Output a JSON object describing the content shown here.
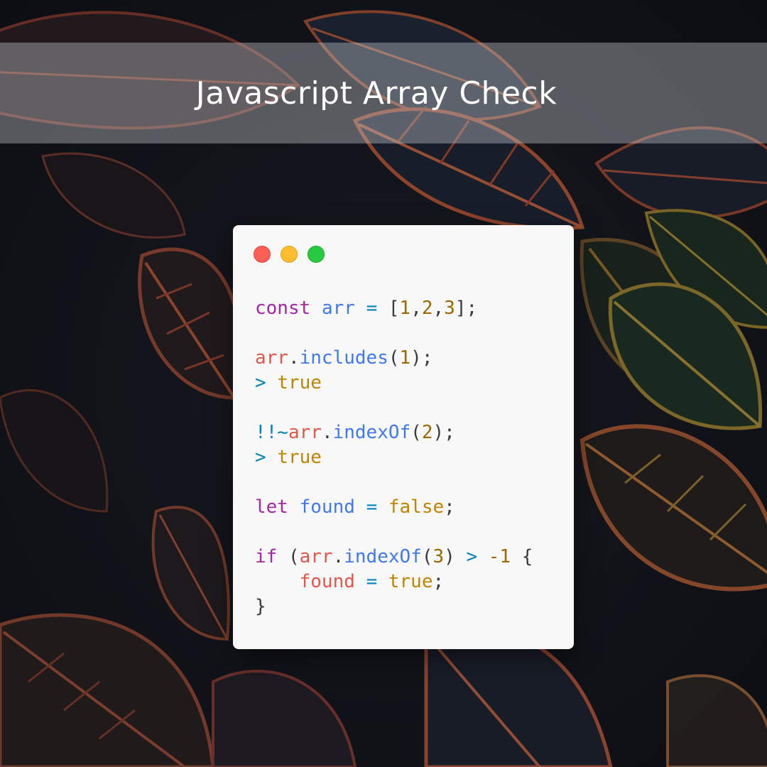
{
  "title": "Javascript Array Check",
  "window": {
    "controls": [
      {
        "name": "close-button",
        "color": "#ff5f56",
        "border": "#e0443e"
      },
      {
        "name": "minimize-button",
        "color": "#ffbd2e",
        "border": "#dea123"
      },
      {
        "name": "zoom-button",
        "color": "#27c93f",
        "border": "#1aab29"
      }
    ]
  },
  "colors": {
    "keyword": "#a626a4",
    "variable": "#e45649",
    "function": "#4078f2",
    "number": "#986801",
    "boolean": "#c18401",
    "operator": "#0184bc",
    "plain": "#383a42",
    "result": "#c18401"
  },
  "code_lines": [
    [
      {
        "text": "const",
        "type": "keyword"
      },
      {
        "text": " ",
        "type": "plain"
      },
      {
        "text": "arr",
        "type": "function"
      },
      {
        "text": " ",
        "type": "plain"
      },
      {
        "text": "=",
        "type": "operator"
      },
      {
        "text": " [",
        "type": "plain"
      },
      {
        "text": "1",
        "type": "number"
      },
      {
        "text": ",",
        "type": "plain"
      },
      {
        "text": "2",
        "type": "number"
      },
      {
        "text": ",",
        "type": "plain"
      },
      {
        "text": "3",
        "type": "number"
      },
      {
        "text": "];",
        "type": "plain"
      }
    ],
    [],
    [
      {
        "text": "arr",
        "type": "variable"
      },
      {
        "text": ".",
        "type": "plain"
      },
      {
        "text": "includes",
        "type": "function"
      },
      {
        "text": "(",
        "type": "plain"
      },
      {
        "text": "1",
        "type": "number"
      },
      {
        "text": ");",
        "type": "plain"
      }
    ],
    [
      {
        "text": ">",
        "type": "operator"
      },
      {
        "text": " ",
        "type": "plain"
      },
      {
        "text": "true",
        "type": "boolean"
      }
    ],
    [],
    [
      {
        "text": "!!~",
        "type": "operator"
      },
      {
        "text": "arr",
        "type": "variable"
      },
      {
        "text": ".",
        "type": "plain"
      },
      {
        "text": "indexOf",
        "type": "function"
      },
      {
        "text": "(",
        "type": "plain"
      },
      {
        "text": "2",
        "type": "number"
      },
      {
        "text": ");",
        "type": "plain"
      }
    ],
    [
      {
        "text": ">",
        "type": "operator"
      },
      {
        "text": " ",
        "type": "plain"
      },
      {
        "text": "true",
        "type": "boolean"
      }
    ],
    [],
    [
      {
        "text": "let",
        "type": "keyword"
      },
      {
        "text": " ",
        "type": "plain"
      },
      {
        "text": "found",
        "type": "function"
      },
      {
        "text": " ",
        "type": "plain"
      },
      {
        "text": "=",
        "type": "operator"
      },
      {
        "text": " ",
        "type": "plain"
      },
      {
        "text": "false",
        "type": "boolean"
      },
      {
        "text": ";",
        "type": "plain"
      }
    ],
    [],
    [
      {
        "text": "if",
        "type": "keyword"
      },
      {
        "text": " (",
        "type": "plain"
      },
      {
        "text": "arr",
        "type": "variable"
      },
      {
        "text": ".",
        "type": "plain"
      },
      {
        "text": "indexOf",
        "type": "function"
      },
      {
        "text": "(",
        "type": "plain"
      },
      {
        "text": "3",
        "type": "number"
      },
      {
        "text": ") ",
        "type": "plain"
      },
      {
        "text": ">",
        "type": "operator"
      },
      {
        "text": " ",
        "type": "plain"
      },
      {
        "text": "-1",
        "type": "number"
      },
      {
        "text": " {",
        "type": "plain"
      }
    ],
    [
      {
        "text": "    ",
        "type": "plain"
      },
      {
        "text": "found",
        "type": "variable"
      },
      {
        "text": " ",
        "type": "plain"
      },
      {
        "text": "=",
        "type": "operator"
      },
      {
        "text": " ",
        "type": "plain"
      },
      {
        "text": "true",
        "type": "boolean"
      },
      {
        "text": ";",
        "type": "plain"
      }
    ],
    [
      {
        "text": "}",
        "type": "plain"
      }
    ]
  ]
}
